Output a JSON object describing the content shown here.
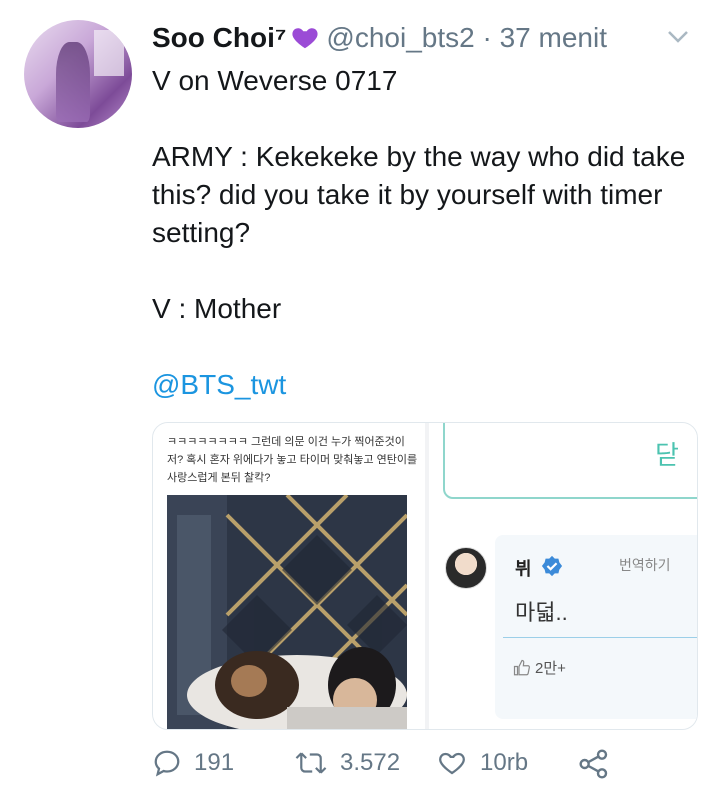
{
  "colors": {
    "text": "#14171a",
    "muted": "#657786",
    "link": "#1b95e0",
    "heart": "#9b4bd6",
    "teal": "#4cc3b0"
  },
  "tweet": {
    "author_name": "Soo Choi⁷",
    "heart_emoji": "purple-heart-icon",
    "handle": "@choi_bts2",
    "separator": "·",
    "time": "37 menit",
    "lines": {
      "line1": "V on Weverse 0717",
      "line2": "ARMY : Kekekeke by the way who did take this? did you take it by yourself with timer setting?",
      "line3": "V : Mother",
      "mention": "@BTS_twt"
    }
  },
  "media": {
    "korean_caption": "ㅋㅋㅋㅋㅋㅋㅋㅋ 그런데 의문 이건 누가 찍어준것이저? 혹시 혼자 위에다가 놓고 타이머 맞춰놓고 연탄이를 사랑스럽게 본뒤 찰칵?",
    "teal_char": "닫",
    "reply_name": "뷔",
    "translate": "번역하기",
    "reply_text": "마덟..",
    "like_count": "2만+",
    "more": "⋮"
  },
  "actions": {
    "replies": "191",
    "retweets": "3.572",
    "likes": "10rb"
  }
}
